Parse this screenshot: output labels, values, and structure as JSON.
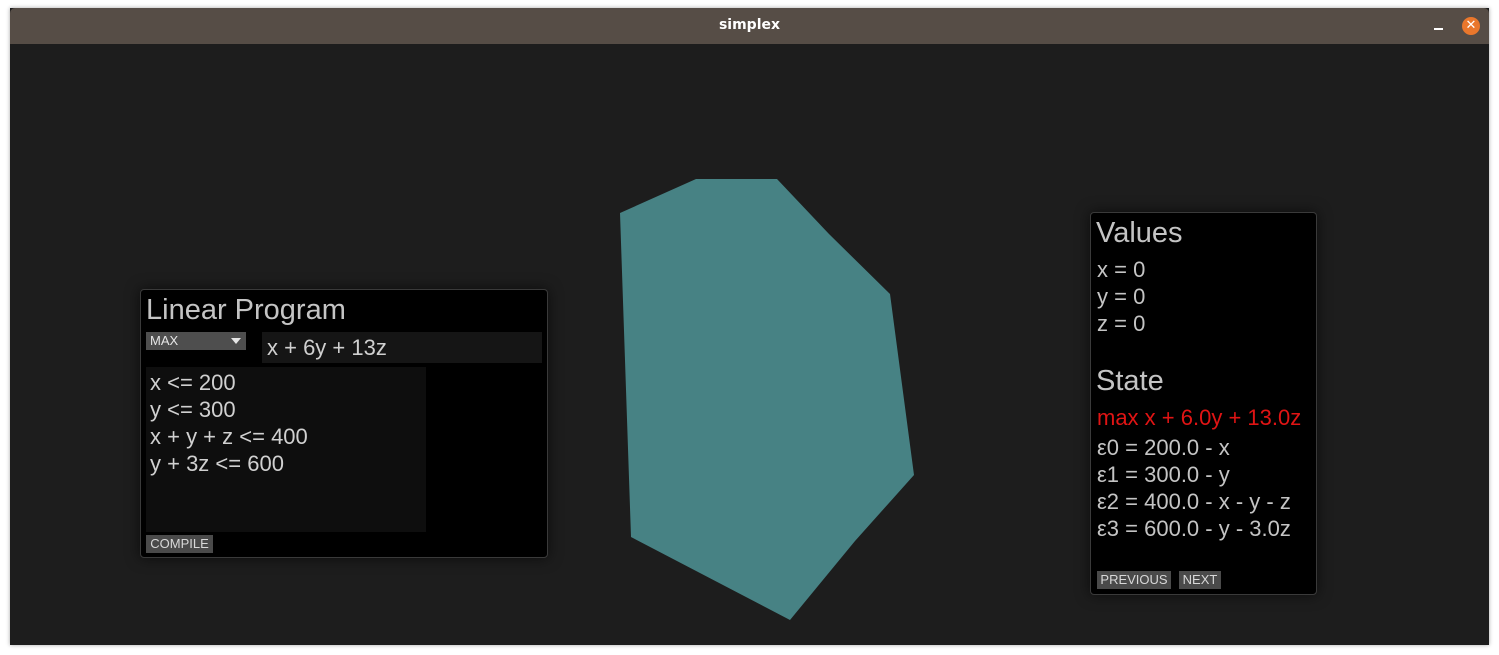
{
  "window": {
    "title": "simplex",
    "minimize_icon": "minimize-icon",
    "close_icon": "close-icon",
    "close_color": "#e9772c"
  },
  "linear_program": {
    "heading": "Linear Program",
    "mode_select": {
      "selected": "MAX",
      "icon": "dropdown-arrow-icon"
    },
    "objective_value": "x + 6y + 13z",
    "constraints": [
      "x <= 200",
      "y <= 300",
      "x + y + z <= 400",
      "y + 3z <= 600"
    ],
    "compile_label": "COMPILE"
  },
  "polytope": {
    "fill_color": "#478284"
  },
  "values_panel": {
    "values_heading": "Values",
    "values": [
      "x = 0",
      "y = 0",
      "z = 0"
    ],
    "state_heading": "State",
    "state_objective": "max x + 6.0y + 13.0z",
    "state_objective_color": "#e01414",
    "state_lines": [
      "ε0 = 200.0 - x",
      "ε1 = 300.0 - y",
      "ε2 = 400.0 - x - y - z",
      "ε3 = 600.0 - y - 3.0z"
    ],
    "previous_label": "PREVIOUS",
    "next_label": "NEXT"
  }
}
